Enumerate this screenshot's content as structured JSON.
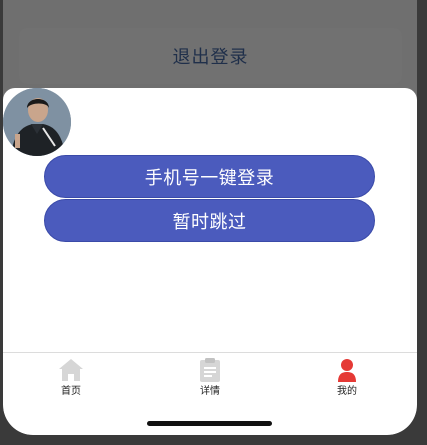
{
  "background": {
    "logout_label": "退出登录"
  },
  "dialog": {
    "avatar_icon": "user-avatar-photo",
    "login_button": "手机号一键登录",
    "skip_button": "暂时跳过"
  },
  "tabbar": {
    "items": [
      {
        "label": "首页",
        "icon": "home-icon",
        "active": false
      },
      {
        "label": "详情",
        "icon": "clipboard-icon",
        "active": false
      },
      {
        "label": "我的",
        "icon": "user-icon",
        "active": true
      }
    ]
  },
  "colors": {
    "button": "#4b5bbd",
    "active_tab": "#e53935",
    "inactive_tab": "#d6d6d6"
  }
}
